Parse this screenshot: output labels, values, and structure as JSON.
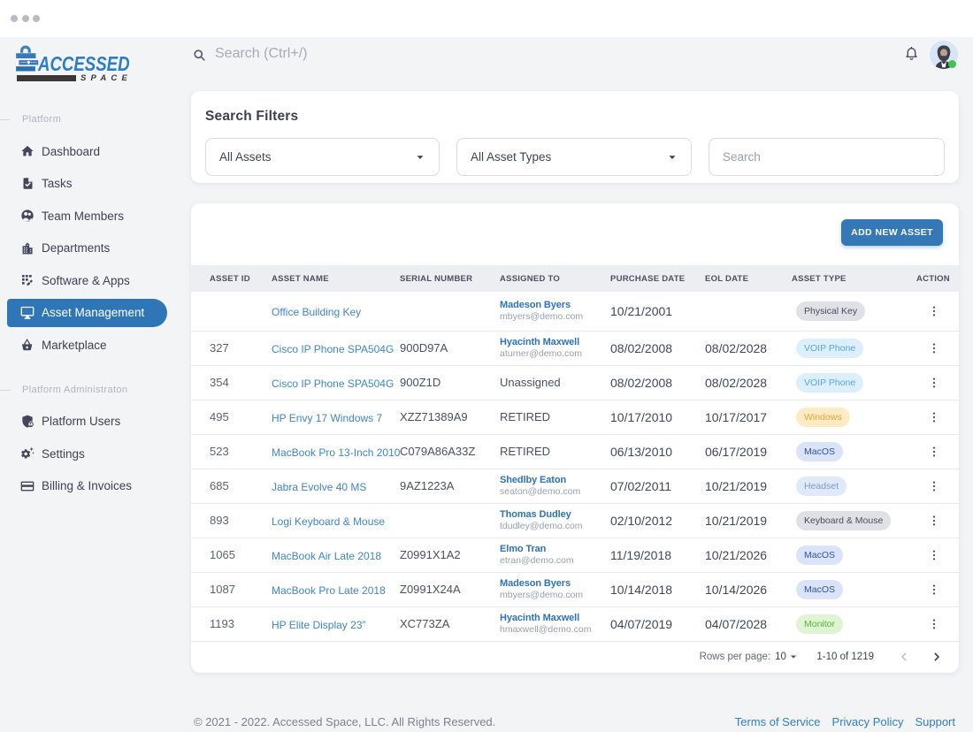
{
  "window": {
    "controls": [
      "close",
      "minimize",
      "maximize"
    ]
  },
  "brand": {
    "name_line1": "ACCESSED",
    "name_line2": "SPACE"
  },
  "topbar": {
    "search_placeholder": "Search (Ctrl+/)",
    "user_status": "online"
  },
  "sidebar": {
    "sections": [
      {
        "label": "Platform",
        "items": [
          {
            "label": "Dashboard",
            "icon": "home-icon",
            "active": false
          },
          {
            "label": "Tasks",
            "icon": "task-icon",
            "active": false
          },
          {
            "label": "Team Members",
            "icon": "team-icon",
            "active": false
          },
          {
            "label": "Departments",
            "icon": "building-icon",
            "active": false
          },
          {
            "label": "Software & Apps",
            "icon": "apps-icon",
            "active": false
          },
          {
            "label": "Asset Management",
            "icon": "monitor-icon",
            "active": true
          },
          {
            "label": "Marketplace",
            "icon": "basket-icon",
            "active": false
          }
        ]
      },
      {
        "label": "Platform Administraton",
        "items": [
          {
            "label": "Platform Users",
            "icon": "shield-user-icon",
            "active": false
          },
          {
            "label": "Settings",
            "icon": "gear-icon",
            "active": false
          },
          {
            "label": "Billing & Invoices",
            "icon": "credit-card-icon",
            "active": false
          }
        ]
      }
    ]
  },
  "filters": {
    "title": "Search Filters",
    "asset_select_value": "All Assets",
    "type_select_value": "All Asset Types",
    "search_placeholder": "Search"
  },
  "table": {
    "add_button_label": "ADD NEW ASSET",
    "columns": [
      "ASSET ID",
      "ASSET NAME",
      "SERIAL NUMBER",
      "ASSIGNED TO",
      "PURCHASE DATE",
      "EOL DATE",
      "ASSET TYPE",
      "ACTION"
    ],
    "rows": [
      {
        "id": "",
        "name": "Office Building Key",
        "serial": "",
        "assigned": "Madeson Byers",
        "email": "mbyers@demo.com",
        "purchase": "10/21/2001",
        "eol": "",
        "type": "Physical Key",
        "type_color": "gray"
      },
      {
        "id": "327",
        "name": "Cisco IP Phone SPA504G",
        "serial": "900D97A",
        "assigned": "Hyacinth Maxwell",
        "email": "aturner@demo.com",
        "purchase": "08/02/2008",
        "eol": "08/02/2028",
        "type": "VOIP Phone",
        "type_color": "sky"
      },
      {
        "id": "354",
        "name": "Cisco IP Phone SPA504G",
        "serial": "900Z1D",
        "assigned": "Unassigned",
        "email": "",
        "purchase": "08/02/2008",
        "eol": "08/02/2028",
        "type": "VOIP Phone",
        "type_color": "sky"
      },
      {
        "id": "495",
        "name": "HP Envy 17 Windows 7",
        "serial": "XZZ71389A9",
        "assigned": "RETIRED",
        "email": "",
        "purchase": "10/17/2010",
        "eol": "10/17/2017",
        "type": "Windows",
        "type_color": "amber"
      },
      {
        "id": "523",
        "name": "MacBook Pro 13-Inch 2010",
        "serial": "C079A86A33Z",
        "assigned": "RETIRED",
        "email": "",
        "purchase": "06/13/2010",
        "eol": "06/17/2019",
        "type": "MacOS",
        "type_color": "indigo"
      },
      {
        "id": "685",
        "name": "Jabra Evolve 40 MS",
        "serial": "9AZ1223A",
        "assigned": "Shedlby Eaton",
        "email": "seaton@demo.com",
        "purchase": "07/02/2011",
        "eol": "10/21/2019",
        "type": "Headset",
        "type_color": "periwinkle"
      },
      {
        "id": "893",
        "name": "Logi Keyboard & Mouse",
        "serial": "",
        "assigned": "Thomas Dudley",
        "email": "tdudley@demo.com",
        "purchase": "02/10/2012",
        "eol": "10/21/2019",
        "type": "Keyboard & Mouse",
        "type_color": "gray"
      },
      {
        "id": "1065",
        "name": "MacBook Air Late 2018",
        "serial": "Z0991X1A2",
        "assigned": "Elmo Tran",
        "email": "etran@demo.com",
        "purchase": "11/19/2018",
        "eol": "10/21/2026",
        "type": "MacOS",
        "type_color": "indigo"
      },
      {
        "id": "1087",
        "name": "MacBook Pro Late 2018",
        "serial": "Z0991X24A",
        "assigned": "Madeson Byers",
        "email": "mbyers@demo.com",
        "purchase": "10/14/2018",
        "eol": "10/14/2026",
        "type": "MacOS",
        "type_color": "indigo"
      },
      {
        "id": "1193",
        "name": "HP Elite Display 23”",
        "serial": "XC773ZA",
        "assigned": "Hyacinth Maxwell",
        "email": "hmaxwell@demo.com",
        "purchase": "04/07/2019",
        "eol": "04/07/2028",
        "type": "Monitor",
        "type_color": "green"
      }
    ],
    "pagination": {
      "rows_per_page_label": "Rows per page:",
      "rows_per_page_value": "10",
      "range_text": "1-10 of 1219"
    }
  },
  "footer": {
    "copyright": "© 2021 - 2022. Accessed Space, LLC. All Rights Reserved.",
    "links": [
      "Terms of Service",
      "Privacy Policy",
      "Support"
    ]
  },
  "colors": {
    "accent_blue": "#2f76b7",
    "link_blue": "#3e86c7",
    "badge_gray_bg": "#e0e1e6",
    "badge_sky_bg": "#ddeffc",
    "badge_amber_bg": "#fdebc4",
    "badge_indigo_bg": "#dae3f7",
    "badge_periwinkle_bg": "#e0e9fa",
    "badge_green_bg": "#def4d2",
    "status_green": "#43c24c"
  }
}
